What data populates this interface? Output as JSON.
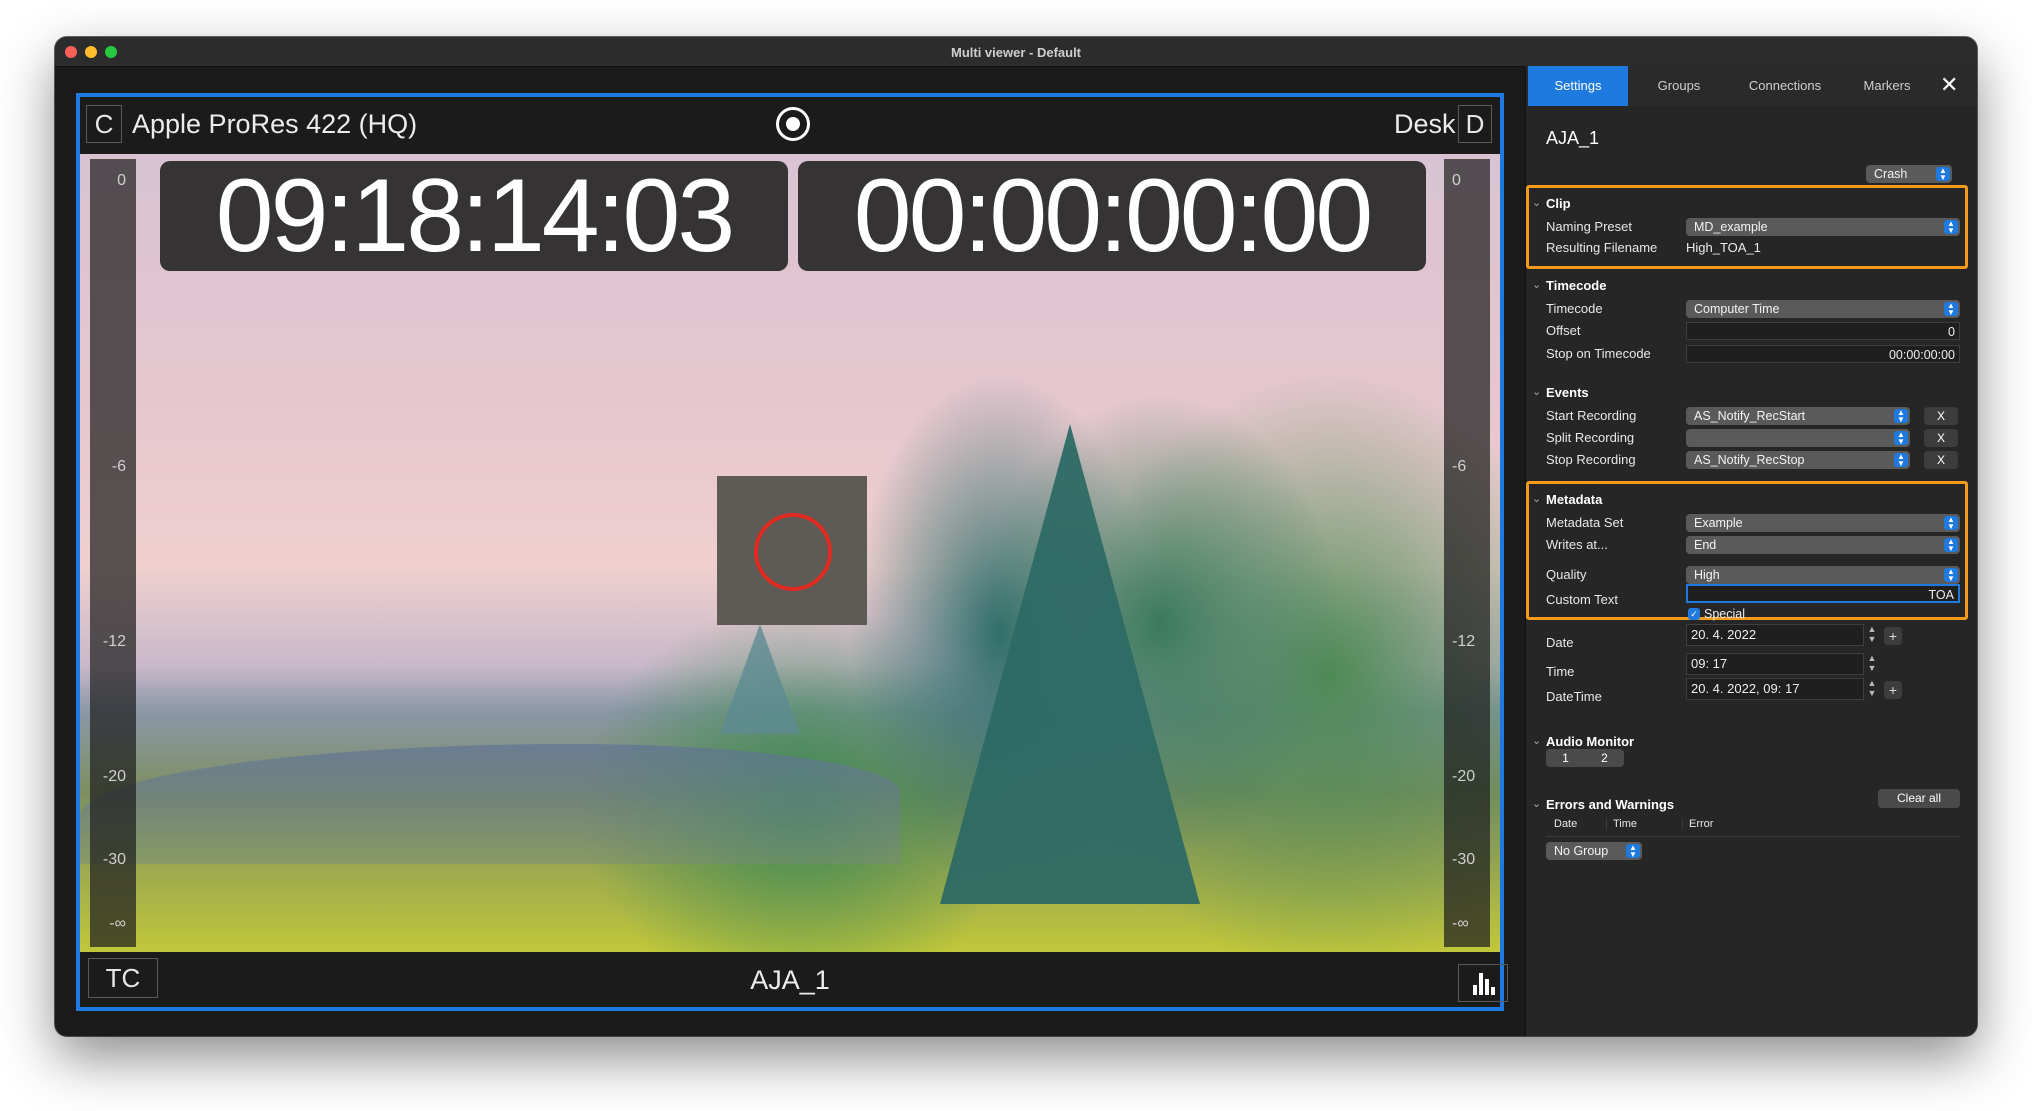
{
  "window": {
    "title": "Multi viewer - Default"
  },
  "viewer": {
    "corner_left": "C",
    "codec": "Apple ProRes 422 (HQ)",
    "label_right": "Desk",
    "corner_right": "D",
    "timecode_1": "09:18:14:03",
    "timecode_2": "00:00:00:00",
    "meter_ticks": [
      "0",
      "-6",
      "-12",
      "-20",
      "-30",
      "-∞"
    ],
    "tc_button": "TC",
    "source_name": "AJA_1"
  },
  "panel": {
    "tabs": [
      "Settings",
      "Groups",
      "Connections",
      "Markers"
    ],
    "close": "✕",
    "source_title": "AJA_1",
    "mode_popup": "Crash",
    "clip": {
      "header": "Clip",
      "naming_preset_label": "Naming Preset",
      "naming_preset_value": "MD_example",
      "filename_label": "Resulting Filename",
      "filename_value": "High_TOA_1"
    },
    "timecode": {
      "header": "Timecode",
      "timecode_label": "Timecode",
      "timecode_value": "Computer Time",
      "offset_label": "Offset",
      "offset_value": "0",
      "stop_label": "Stop on Timecode",
      "stop_value": "00:00:00:00"
    },
    "events": {
      "header": "Events",
      "start_label": "Start Recording",
      "start_value": "AS_Notify_RecStart",
      "split_label": "Split Recording",
      "split_value": "",
      "stop_label": "Stop Recording",
      "stop_value": "AS_Notify_RecStop",
      "clear": "X"
    },
    "metadata": {
      "header": "Metadata",
      "set_label": "Metadata Set",
      "set_value": "Example",
      "writes_label": "Writes at...",
      "writes_value": "End",
      "quality_label": "Quality",
      "quality_value": "High",
      "custom_label": "Custom Text",
      "custom_value": "TOA",
      "special_label": "Special",
      "date_label": "Date",
      "date_value": "20. 4. 2022",
      "time_label": "Time",
      "time_value": "09: 17",
      "datetime_label": "DateTime",
      "datetime_value": "20. 4. 2022, 09: 17"
    },
    "audio": {
      "header": "Audio Monitor",
      "channels": [
        "1",
        "2"
      ]
    },
    "errors": {
      "header": "Errors and Warnings",
      "clear_all": "Clear all",
      "columns": [
        "Date",
        "Time",
        "Error"
      ]
    },
    "group_popup": "No Group"
  },
  "colors": {
    "accent": "#1f7ae0",
    "highlight": "#f29a1c",
    "record": "#e02b20"
  }
}
